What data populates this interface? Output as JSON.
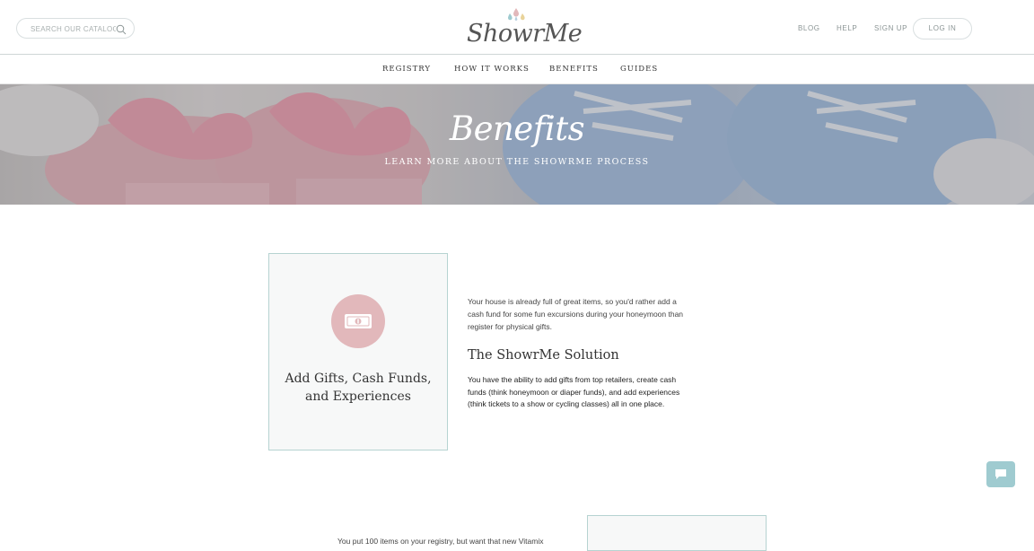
{
  "header": {
    "search_placeholder": "SEARCH OUR CATALOG",
    "logo_text": "ShowrMe",
    "links": {
      "blog": "BLOG",
      "help": "HELP",
      "signup": "SIGN UP",
      "login": "LOG IN"
    }
  },
  "nav": {
    "registry": "REGISTRY",
    "how_it_works": "HOW IT WORKS",
    "benefits": "BENEFITS",
    "guides": "GUIDES"
  },
  "hero": {
    "title": "Benefits",
    "subtitle": "LEARN MORE ABOUT THE SHOWRME PROCESS"
  },
  "feature": {
    "icon": "money-icon",
    "title_line1": "Add Gifts, Cash Funds,",
    "title_line2": "and Experiences",
    "description": "Your house is already full of great items, so you'd rather add a cash fund for some fun excursions during your honeymoon than register for physical gifts.",
    "solution_heading": "The ShowrMe Solution",
    "solution_text": "You have the ability to add gifts from top retailers, create cash funds (think honeymoon or diaper funds), and add experiences (think tickets to a show or cycling classes) all in one place."
  },
  "next_feature": {
    "text": "You put 100 items on your registry, but want that new Vitamix"
  },
  "colors": {
    "accent_pink": "#e2b8bb",
    "card_border": "#b6d3d1",
    "chat_button": "#9fcbd0"
  }
}
